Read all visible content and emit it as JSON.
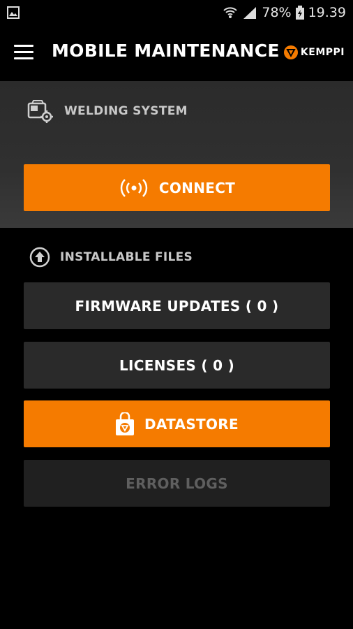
{
  "status_bar": {
    "battery_percent": "78%",
    "time": "19.39",
    "icons": [
      "gallery-icon",
      "wifi-icon",
      "signal-icon",
      "battery-icon"
    ]
  },
  "app_bar": {
    "title": "MOBILE MAINTENANCE",
    "brand": "KEMPPI"
  },
  "welding_section": {
    "label": "WELDING SYSTEM",
    "connect_button": "CONNECT"
  },
  "installable_section": {
    "label": "INSTALLABLE FILES",
    "firmware_button": "FIRMWARE UPDATES ( 0 )",
    "licenses_button": "LICENSES ( 0 )",
    "datastore_button": "DATASTORE",
    "error_logs_button": "ERROR LOGS"
  },
  "colors": {
    "accent": "#f57b00",
    "background": "#000000",
    "panel": "#2f2f2f",
    "button_dark": "#2a2a2a",
    "disabled_text": "#5f5f5f"
  }
}
